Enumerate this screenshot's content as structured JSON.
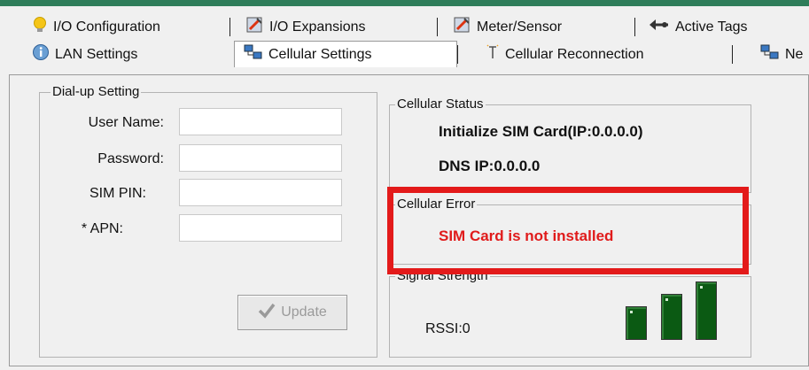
{
  "tabs_row1": [
    {
      "label": "I/O Configuration",
      "icon": "lightbulb-icon"
    },
    {
      "label": "I/O Expansions",
      "icon": "wrench-icon"
    },
    {
      "label": "Meter/Sensor",
      "icon": "meter-icon"
    },
    {
      "label": "Active Tags",
      "icon": "tag-icon"
    }
  ],
  "tabs_row2": [
    {
      "label": "LAN Settings",
      "icon": "info-icon"
    },
    {
      "label": "Cellular Settings",
      "icon": "network-icon",
      "active": true
    },
    {
      "label": "Cellular Reconnection",
      "icon": "cursor-icon"
    },
    {
      "label": "Ne",
      "icon": "network-icon"
    }
  ],
  "dialup": {
    "legend": "Dial-up Setting",
    "fields": [
      {
        "label": "User Name:",
        "value": ""
      },
      {
        "label": "Password:",
        "value": ""
      },
      {
        "label": "SIM PIN:",
        "value": ""
      },
      {
        "label": "* APN:",
        "value": ""
      }
    ],
    "update_label": "Update"
  },
  "status": {
    "legend": "Cellular Status",
    "line1": "Initialize SIM Card(IP:0.0.0.0)",
    "line2": "DNS IP:0.0.0.0"
  },
  "error": {
    "legend": "Cellular Error",
    "message": "SIM Card is not installed",
    "message_color": "#e01b1b"
  },
  "signal": {
    "legend": "Signal Strength",
    "rssi": "RSSI:0",
    "bar_color": "#0b5a13"
  },
  "colors": {
    "highlight": "#e31a1a",
    "top_accent": "#2f7d5a"
  }
}
